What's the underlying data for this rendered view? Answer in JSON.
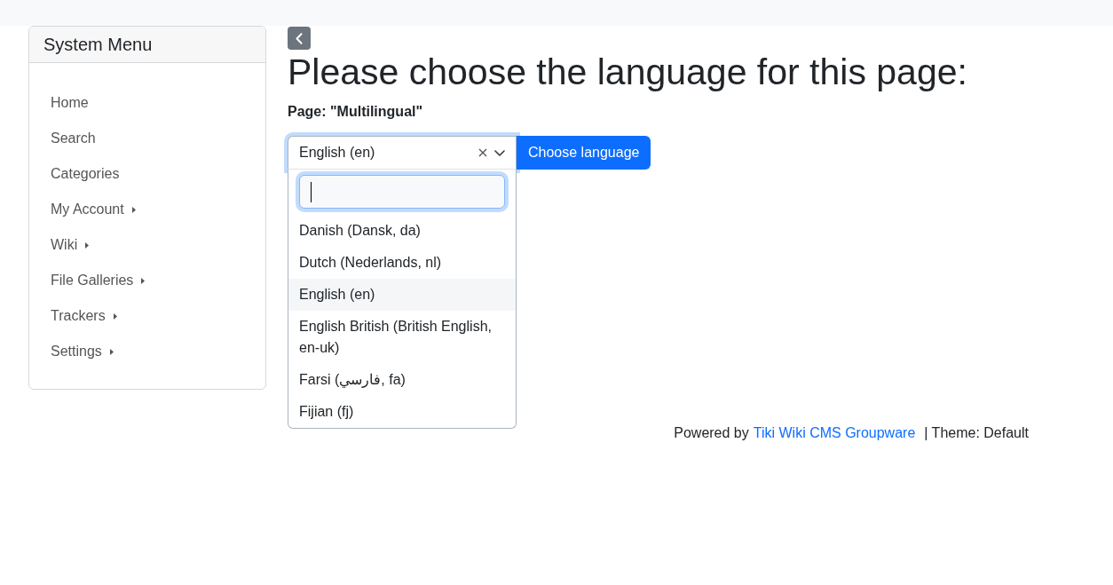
{
  "sidebar": {
    "title": "System Menu",
    "items": [
      {
        "label": "Home",
        "expandable": false
      },
      {
        "label": "Search",
        "expandable": false
      },
      {
        "label": "Categories",
        "expandable": false
      },
      {
        "label": "My Account",
        "expandable": true
      },
      {
        "label": "Wiki",
        "expandable": true
      },
      {
        "label": "File Galleries",
        "expandable": true
      },
      {
        "label": "Trackers",
        "expandable": true
      },
      {
        "label": "Settings",
        "expandable": true
      }
    ]
  },
  "heading": "Please choose the language for this page:",
  "page_label": "Page: \"Multilingual\"",
  "language_select": {
    "value": "English (en)",
    "expanded": true,
    "options": [
      {
        "label": "Danish (Dansk, da)",
        "selected": false
      },
      {
        "label": "Dutch (Nederlands, nl)",
        "selected": false
      },
      {
        "label": "English (en)",
        "selected": true
      },
      {
        "label": "English British (British English, en-uk)",
        "selected": false
      },
      {
        "label": "Farsi (فارسي, fa)",
        "selected": false
      },
      {
        "label": "Fijian (fj)",
        "selected": false
      }
    ]
  },
  "choose_button": "Choose language",
  "footer": {
    "powered_by": "Powered by",
    "link": "Tiki Wiki CMS Groupware",
    "theme": "| Theme: Default"
  }
}
